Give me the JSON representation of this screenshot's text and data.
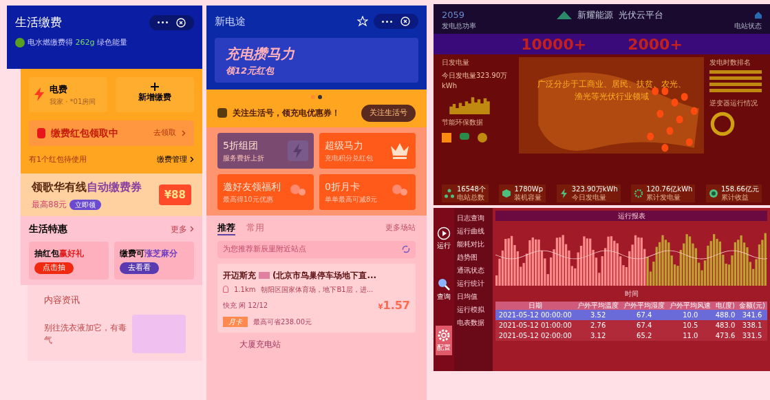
{
  "bill_app": {
    "title": "生活缴费",
    "energy_note": {
      "prefix": "电水燃缴费得",
      "amount": "262g",
      "suffix": "绿色能量"
    },
    "bill_card": {
      "name": "电费",
      "account": "我家 · *01房间"
    },
    "add_bill": "新增缴费",
    "red_packet": {
      "title": "缴费红包领取中",
      "action": "去领取"
    },
    "pending_note": "有1个红包待使用",
    "manage_link": "缴费管理",
    "promo": {
      "title_dark": "领歌华有线",
      "title_accent": "自动缴费券",
      "subtitle": "最高88元",
      "button": "立即领",
      "badge": "¥88"
    },
    "offers": {
      "title": "生活特惠",
      "more": "更多",
      "items": [
        {
          "kind": "gift",
          "title_dark": "抽红包",
          "title_accent": "赢好礼",
          "button": "点击抽"
        },
        {
          "kind": "sesame",
          "title_dark": "缴费可",
          "title_accent": "涨芝麻分",
          "button": "去看看"
        }
      ]
    },
    "news": {
      "title": "内容资讯",
      "headline": "别往洗衣液加它，有毒气"
    }
  },
  "charging_app": {
    "title": "新电途",
    "banner": {
      "title": "充电攒马力",
      "subtitle": "领12元红包"
    },
    "follow": {
      "text": "关注生活号，领充电优惠券！",
      "button": "关注生活号"
    },
    "tiles": [
      {
        "kind": "bolt",
        "title": "5折组团",
        "subtitle": "服务费折上折"
      },
      {
        "kind": "crown",
        "title": "超级马力",
        "subtitle": "充电积分兑红包"
      },
      {
        "kind": "people",
        "title": "邀好友领福利",
        "subtitle": "最高得10元优惠"
      },
      {
        "kind": "people",
        "title": "0折月卡",
        "subtitle": "单单最高可减8元"
      }
    ],
    "tabs": [
      {
        "label": "推荐",
        "selected": true
      },
      {
        "label": "常用",
        "selected": false
      }
    ],
    "more": "更多场站",
    "nearby_hint": "为您推荐新辰里附近站点",
    "station": {
      "name_start": "开迈斯充",
      "name_end": "(北京市鸟巢停车场地下直...",
      "distance": "1.1km",
      "address": "朝阳区国家体育场，地下B1层，进...",
      "status": "快充 闲 12/12",
      "price": "1.57",
      "currency": "¥",
      "card_badge": "月卡",
      "card_note": "最高可省238.00元"
    },
    "next_station": "大厦充电站"
  },
  "dashboard": {
    "counter": "2059",
    "brand": "新耀能源",
    "platform": "光伏云平台",
    "left_label": "发电总功率",
    "right_label": "电站状态",
    "big_numbers": [
      "10000+",
      "2000+"
    ],
    "tagline": [
      "广泛分步于工商业、居民、扶贫、农光、",
      "渔光等光伏行业领域"
    ],
    "daily_title": "日发电量",
    "daily_note": "今日发电量323.90万kWh",
    "ranking_title": "发电时数排名",
    "eco_title": "节能环保数据",
    "inverter_title": "逆变器运行情况",
    "stats": [
      {
        "kind": "network",
        "value": "16548个",
        "label": "电站总数"
      },
      {
        "kind": "cube",
        "value": "1780Wp",
        "label": "装机容量"
      },
      {
        "kind": "bolt",
        "value": "323.90万kWh",
        "label": "今日发电量"
      },
      {
        "kind": "gear",
        "value": "120.76亿kWh",
        "label": "累计发电量"
      },
      {
        "kind": "coin",
        "value": "158.66亿元",
        "label": "累计收益"
      }
    ]
  },
  "analysis": {
    "nav": [
      {
        "kind": "play",
        "label": "运行",
        "selected": false
      },
      {
        "kind": "search",
        "label": "查询",
        "selected": false
      },
      {
        "kind": "gear",
        "label": "配置",
        "selected": true
      }
    ],
    "menu": [
      "日志查询",
      "运行曲线",
      "能耗对比",
      "趋势图",
      "通讯状态",
      "运行统计",
      "日均值",
      "运行模拟",
      "电表数据"
    ],
    "report_title": "运行报表",
    "xlabel": "时间",
    "columns": [
      "日期",
      "户外平均温度",
      "户外平均湿度",
      "户外平均风速",
      "电(度)",
      "金额(元)"
    ],
    "rows": [
      {
        "selected": true,
        "cells": [
          "2021-05-12 00:00:00",
          "3.52",
          "67.4",
          "10.0",
          "488.0",
          "341.6"
        ]
      },
      {
        "selected": false,
        "cells": [
          "2021-05-12 01:00:00",
          "2.76",
          "67.4",
          "10.5",
          "483.0",
          "338.1"
        ]
      },
      {
        "selected": false,
        "cells": [
          "2021-05-12 02:00:00",
          "3.12",
          "65.2",
          "11.0",
          "473.6",
          "331.5"
        ]
      }
    ]
  }
}
